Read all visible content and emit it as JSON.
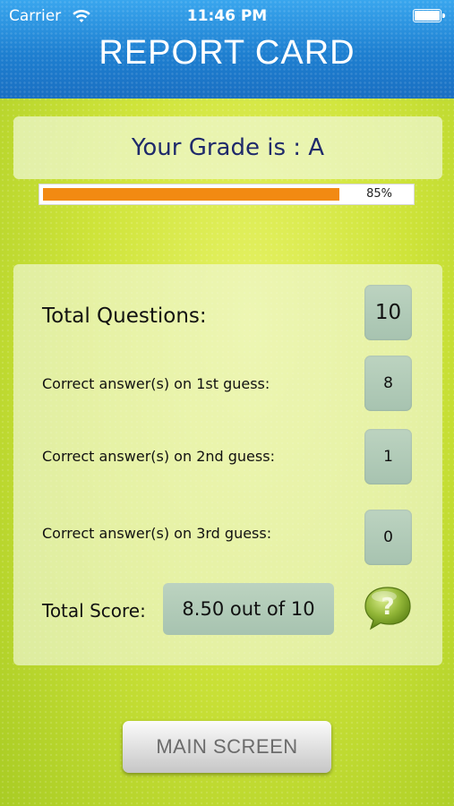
{
  "status_bar": {
    "carrier": "Carrier",
    "time": "11:46 PM"
  },
  "header": {
    "title": "REPORT CARD"
  },
  "grade": {
    "text": "Your Grade is : A",
    "progress_percent": 85,
    "progress_label": "85%"
  },
  "stats": {
    "total_questions_label": "Total Questions:",
    "total_questions_value": "10",
    "first_guess_label": "Correct answer(s) on 1st guess:",
    "first_guess_value": "8",
    "second_guess_label": "Correct answer(s) on 2nd guess:",
    "second_guess_value": "1",
    "third_guess_label": "Correct answer(s) on 3rd guess:",
    "third_guess_value": "0",
    "total_score_label": "Total Score:",
    "total_score_value": "8.50 out of 10"
  },
  "footer": {
    "main_screen_label": "MAIN SCREEN"
  },
  "icons": {
    "wifi": "wifi-icon",
    "battery": "battery-icon",
    "help": "help-bubble-icon"
  },
  "colors": {
    "header_blue": "#1e7fd0",
    "background_green": "#cfe43a",
    "progress_orange": "#f28a12",
    "grade_text": "#1f2a6b"
  }
}
